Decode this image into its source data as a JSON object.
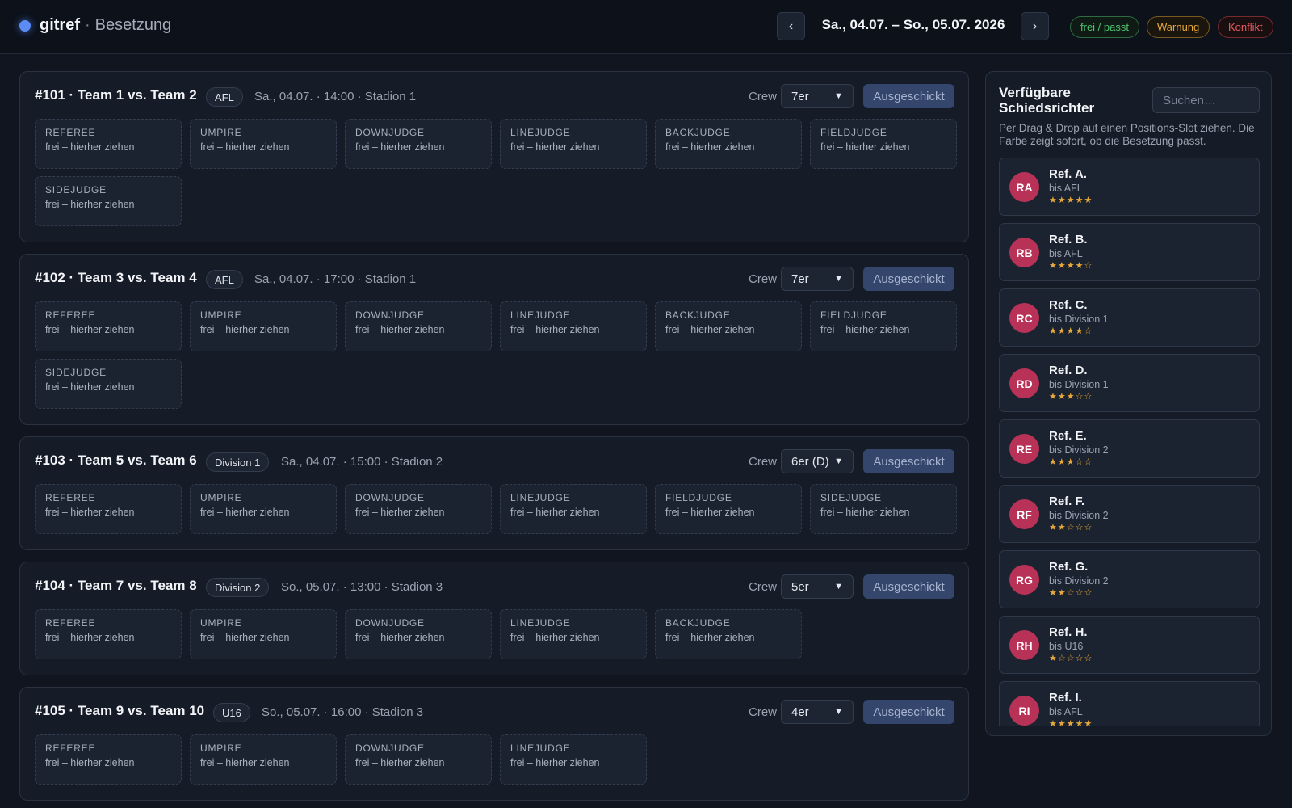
{
  "header": {
    "brand": "gitref",
    "separator": "·",
    "subtitle": "Besetzung",
    "prev_label": "‹",
    "next_label": "›",
    "date_range": "Sa., 04.07. – So., 05.07. 2026",
    "legend": {
      "ok": "frei / passt",
      "warning": "Warnung",
      "conflict": "Konflikt"
    }
  },
  "colors": {
    "accent": "#5b8cf6",
    "ok": "#4ec26f",
    "warning": "#e7a83b",
    "conflict": "#e85a5f",
    "avatar": "#b83156"
  },
  "crew_label": "Crew",
  "slot_hint": "frei – hierher ziehen",
  "sent_label": "Ausgeschickt",
  "games": [
    {
      "title": "#101 · Team 1 vs. Team 2",
      "league": "AFL",
      "meta": "Sa., 04.07. · 14:00 · Stadion 1",
      "crew": "7er",
      "roles": [
        "REFEREE",
        "UMPIRE",
        "DOWNJUDGE",
        "LINEJUDGE",
        "BACKJUDGE",
        "FIELDJUDGE",
        "SIDEJUDGE"
      ]
    },
    {
      "title": "#102 · Team 3 vs. Team 4",
      "league": "AFL",
      "meta": "Sa., 04.07. · 17:00 · Stadion 1",
      "crew": "7er",
      "roles": [
        "REFEREE",
        "UMPIRE",
        "DOWNJUDGE",
        "LINEJUDGE",
        "BACKJUDGE",
        "FIELDJUDGE",
        "SIDEJUDGE"
      ]
    },
    {
      "title": "#103 · Team 5 vs. Team 6",
      "league": "Division 1",
      "meta": "Sa., 04.07. · 15:00 · Stadion 2",
      "crew": "6er (D)",
      "roles": [
        "REFEREE",
        "UMPIRE",
        "DOWNJUDGE",
        "LINEJUDGE",
        "FIELDJUDGE",
        "SIDEJUDGE"
      ]
    },
    {
      "title": "#104 · Team 7 vs. Team 8",
      "league": "Division 2",
      "meta": "So., 05.07. · 13:00 · Stadion 3",
      "crew": "5er",
      "roles": [
        "REFEREE",
        "UMPIRE",
        "DOWNJUDGE",
        "LINEJUDGE",
        "BACKJUDGE"
      ]
    },
    {
      "title": "#105 · Team 9 vs. Team 10",
      "league": "U16",
      "meta": "So., 05.07. · 16:00 · Stadion 3",
      "crew": "4er",
      "roles": [
        "REFEREE",
        "UMPIRE",
        "DOWNJUDGE",
        "LINEJUDGE"
      ]
    }
  ],
  "sidebar": {
    "title": "Verfügbare Schiedsrichter",
    "search_placeholder": "Suchen…",
    "description": "Per Drag & Drop auf einen Positions-Slot ziehen. Die Farbe zeigt sofort, ob die Besetzung passt.",
    "refs": [
      {
        "initials": "RA",
        "name": "Ref. A.",
        "level": "bis AFL",
        "rating": 5
      },
      {
        "initials": "RB",
        "name": "Ref. B.",
        "level": "bis AFL",
        "rating": 4
      },
      {
        "initials": "RC",
        "name": "Ref. C.",
        "level": "bis Division 1",
        "rating": 4
      },
      {
        "initials": "RD",
        "name": "Ref. D.",
        "level": "bis Division 1",
        "rating": 3
      },
      {
        "initials": "RE",
        "name": "Ref. E.",
        "level": "bis Division 2",
        "rating": 3
      },
      {
        "initials": "RF",
        "name": "Ref. F.",
        "level": "bis Division 2",
        "rating": 2
      },
      {
        "initials": "RG",
        "name": "Ref. G.",
        "level": "bis Division 2",
        "rating": 2
      },
      {
        "initials": "RH",
        "name": "Ref. H.",
        "level": "bis U16",
        "rating": 1
      },
      {
        "initials": "RI",
        "name": "Ref. I.",
        "level": "bis AFL",
        "rating": 5
      }
    ]
  }
}
